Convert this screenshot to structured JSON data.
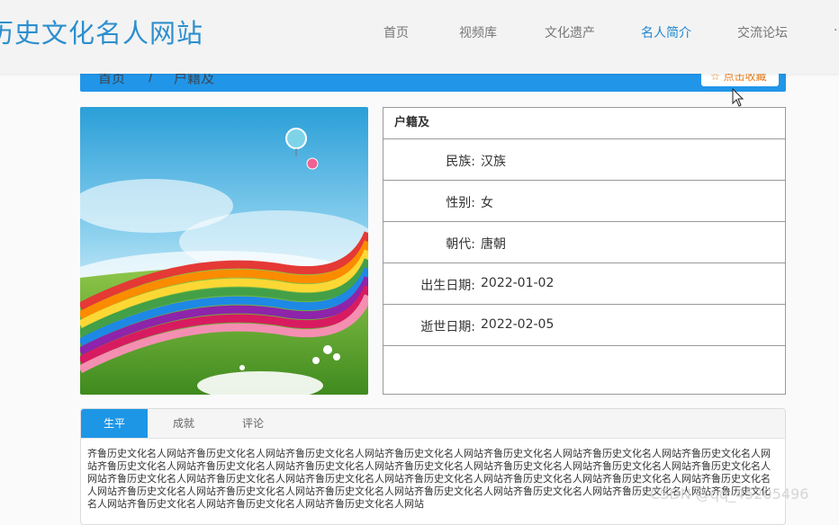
{
  "header": {
    "site_title": "历史文化名人网站",
    "nav": [
      {
        "label": "首页"
      },
      {
        "label": "视频库"
      },
      {
        "label": "文化遗产"
      },
      {
        "label": "名人简介",
        "active": true
      },
      {
        "label": "交流论坛"
      }
    ]
  },
  "breadcrumb": {
    "home": "首页",
    "separator": "/",
    "current": "户籍及",
    "favorite_label": "☆ 点击收藏"
  },
  "profile": {
    "name": "户籍及",
    "fields": [
      {
        "label": "民族:",
        "value": "汉族"
      },
      {
        "label": "性别:",
        "value": "女"
      },
      {
        "label": "朝代:",
        "value": "唐朝"
      },
      {
        "label": "出生日期:",
        "value": "2022-01-02"
      },
      {
        "label": "逝世日期:",
        "value": "2022-02-05"
      }
    ]
  },
  "tabs": {
    "items": [
      {
        "label": "生平",
        "active": true
      },
      {
        "label": "成就"
      },
      {
        "label": "评论"
      }
    ],
    "bio_text": "齐鲁历史文化名人网站齐鲁历史文化名人网站齐鲁历史文化名人网站齐鲁历史文化名人网站齐鲁历史文化名人网站齐鲁历史文化名人网站齐鲁历史文化名人网站齐鲁历史文化名人网站齐鲁历史文化名人网站齐鲁历史文化名人网站齐鲁历史文化名人网站齐鲁历史文化名人网站齐鲁历史文化名人网站齐鲁历史文化名人网站齐鲁历史文化名人网站齐鲁历史文化名人网站齐鲁历史文化名人网站齐鲁历史文化名人网站齐鲁历史文化名人网站齐鲁历史文化名人网站齐鲁历史文化名人网站齐鲁历史文化名人网站齐鲁历史文化名人网站齐鲁历史文化名人网站齐鲁历史文化名人网站齐鲁历史文化名人网站齐鲁历史文化名人网站齐鲁历史文化名人网站齐鲁历史文化名人网站齐鲁历史文化名人网站齐鲁历史文化名人网站"
  },
  "watermark": "CSDN @qq_45205496",
  "colors": {
    "accent": "#2196e8",
    "title": "#2c8fce",
    "nav_active": "#1e88d0",
    "favorite": "#e07a1a"
  }
}
